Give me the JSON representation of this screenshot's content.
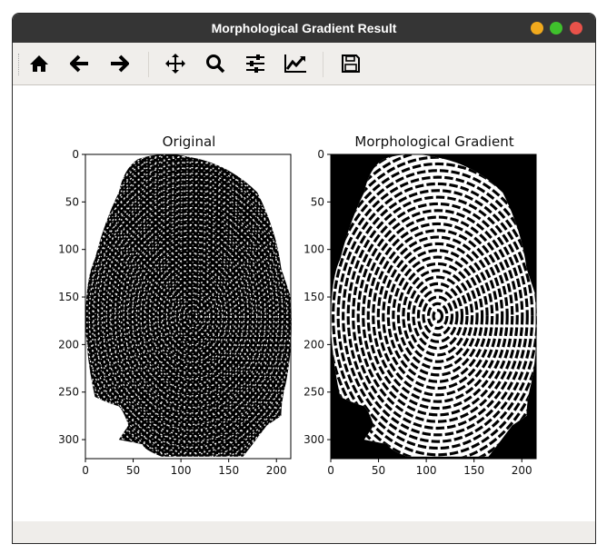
{
  "window": {
    "title": "Morphological Gradient Result",
    "buttons": {
      "minimize": "#f0a91d",
      "maximize": "#3fc12c",
      "close": "#e9524a"
    }
  },
  "toolbar": {
    "items": [
      "home-icon",
      "back-arrow-icon",
      "forward-arrow-icon",
      "pan-icon",
      "zoom-icon",
      "subplots-icon",
      "axes-edit-icon",
      "save-icon"
    ]
  },
  "chart_data": [
    {
      "type": "heatmap",
      "title": "Original",
      "xticks": [
        0,
        50,
        100,
        150,
        200
      ],
      "yticks": [
        0,
        50,
        100,
        150,
        200,
        250,
        300
      ],
      "xlim": [
        0,
        215
      ],
      "ylim": [
        320,
        0
      ],
      "colormap": "gray",
      "background": "white",
      "content": "fingerprint"
    },
    {
      "type": "heatmap",
      "title": "Morphological Gradient",
      "xticks": [
        0,
        50,
        100,
        150,
        200
      ],
      "yticks": [
        0,
        50,
        100,
        150,
        200,
        250,
        300
      ],
      "xlim": [
        0,
        215
      ],
      "ylim": [
        320,
        0
      ],
      "colormap": "gray",
      "background": "black",
      "content": "fingerprint"
    }
  ]
}
